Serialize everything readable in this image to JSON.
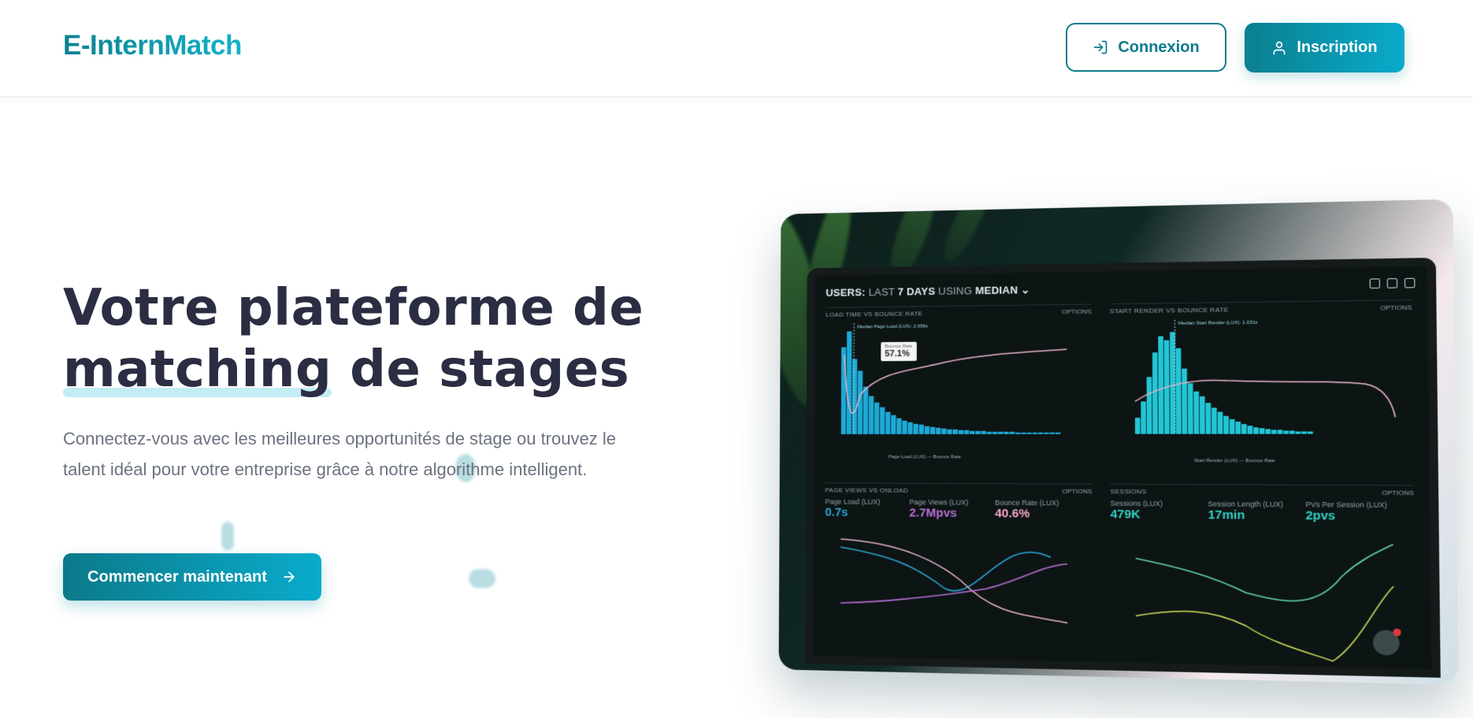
{
  "nav": {
    "logo": "E-InternMatch",
    "login_label": "Connexion",
    "signup_label": "Inscription",
    "login_icon": "login-arrow-icon",
    "signup_icon": "user-icon"
  },
  "hero": {
    "title_line1": "Votre plateforme de",
    "title_highlight": "matching",
    "title_rest": " de stages",
    "description": "Connectez-vous avec les meilleures opportunités de stage ou trouvez le talent idéal pour votre entreprise grâce à notre algorithme intelligent.",
    "cta_label": "Commencer maintenant",
    "cta_icon": "arrow-right-icon"
  },
  "dashboard": {
    "title_prefix": "USERS:",
    "title_mid": " LAST ",
    "title_bold": "7 DAYS",
    "title_using": " USING ",
    "title_end": "MEDIAN",
    "panel1_label": "LOAD TIME VS BOUNCE RATE",
    "panel2_label": "START RENDER VS BOUNCE RATE",
    "panel3_label": "PAGE VIEWS VS ONLOAD",
    "panel4_label": "SESSIONS",
    "options_label": "OPTIONS",
    "tooltip_label": "Bounce Rate",
    "tooltip_value": "57.1%",
    "median1": "Median Page Load (LUX): 2.056s",
    "median2": "Median Start Render (LUX): 1.031s",
    "legend1": "Page Load (LUX)  —  Bounce Rate",
    "legend2": "Start Render (LUX)  —  Bounce Rate",
    "metrics": [
      {
        "label": "Page Load (LUX)",
        "value": "0.7s",
        "color": "#2aa7d8"
      },
      {
        "label": "Page Views (LUX)",
        "value": "2.7Mpvs",
        "color": "#b66fd1"
      },
      {
        "label": "Bounce Rate (LUX)",
        "value": "40.6%",
        "color": "#f3a7c4"
      },
      {
        "label": "Sessions (LUX)",
        "value": "479K",
        "color": "#2fd1c3"
      },
      {
        "label": "Session Length (LUX)",
        "value": "17min",
        "color": "#2fd1c3"
      },
      {
        "label": "PVs Per Session (LUX)",
        "value": "2pvs",
        "color": "#2fd1c3"
      }
    ]
  },
  "colors": {
    "brand": "#0b7b8b",
    "brand_light": "#0aabcc",
    "heading": "#2b2d42",
    "text_muted": "#6b7280"
  }
}
